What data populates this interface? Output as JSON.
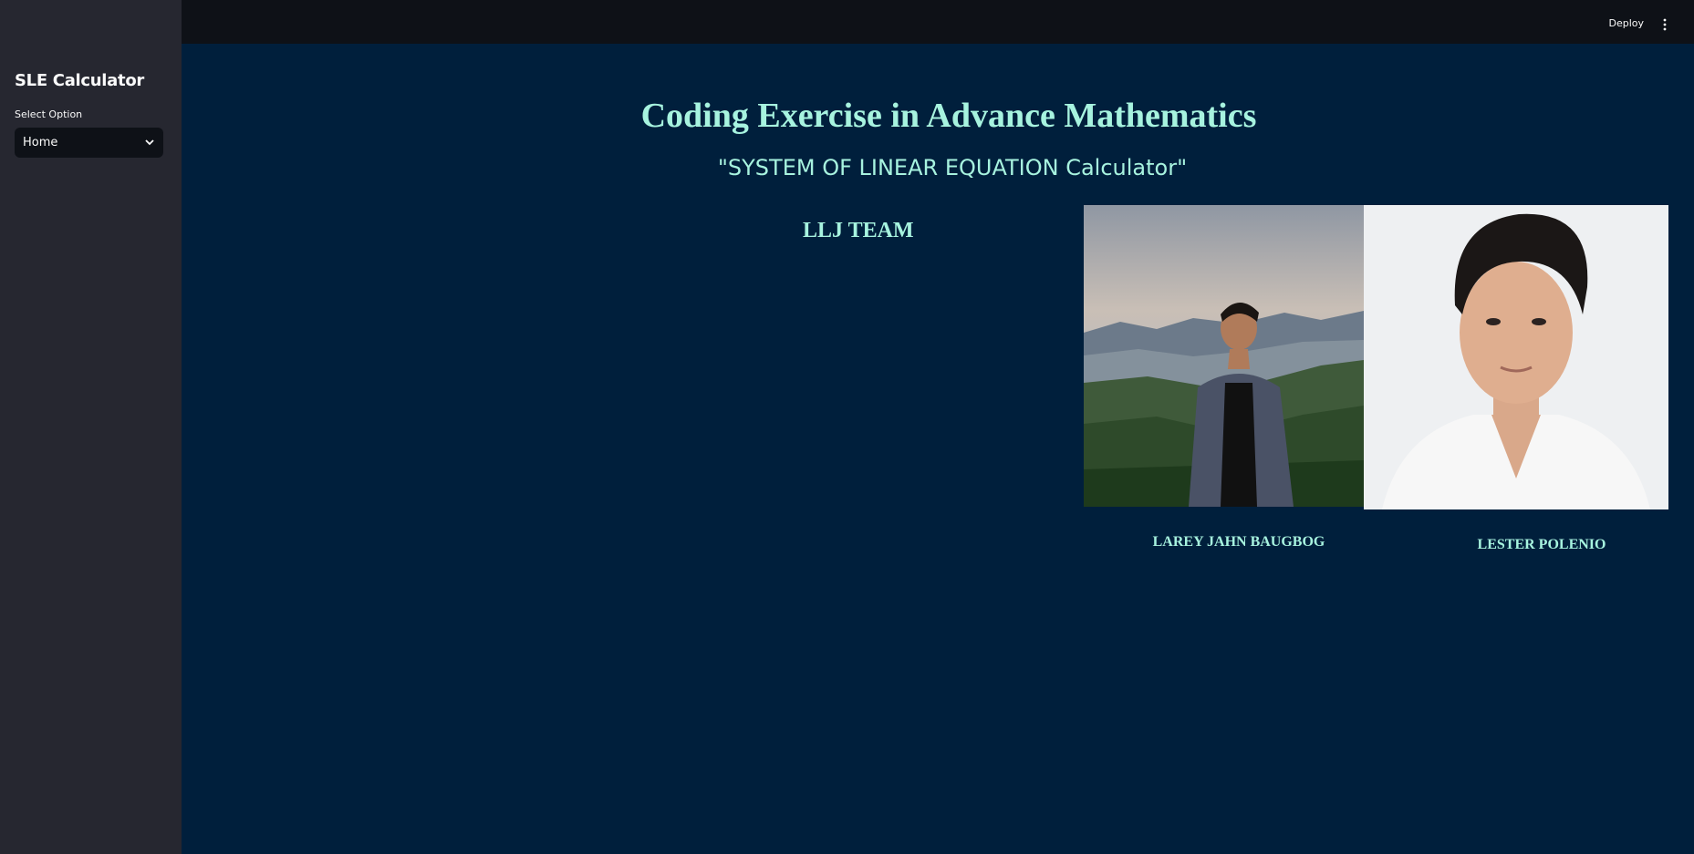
{
  "sidebar": {
    "title": "SLE Calculator",
    "select_label": "Select Option",
    "select_value": "Home"
  },
  "topbar": {
    "deploy_label": "Deploy"
  },
  "main": {
    "title": "Coding Exercise in Advance Mathematics",
    "subtitle": "\"SYSTEM OF LINEAR EQUATION Calculator\"",
    "team": "LLJ TEAM",
    "members": [
      {
        "name": "LAREY JAHN BAUGBOG"
      },
      {
        "name": "LESTER POLENIO"
      }
    ]
  },
  "colors": {
    "background": "#001f3c",
    "sidebar": "#262730",
    "topbar": "#0e1117",
    "accent_text": "#a7f3df"
  }
}
